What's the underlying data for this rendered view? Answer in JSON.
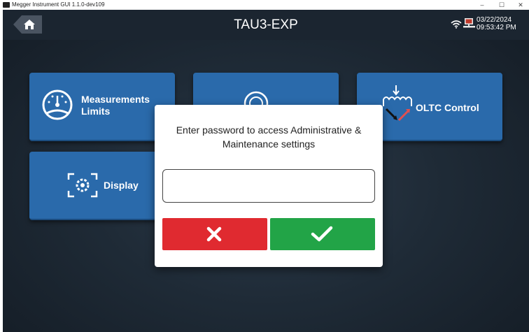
{
  "window": {
    "title": "Megger Instrument GUI 1.1.0-dev109",
    "controls": {
      "minimize": "–",
      "maximize": "☐",
      "close": "✕"
    }
  },
  "header": {
    "title": "TAU3-EXP",
    "date": "03/22/2024",
    "time": "09:53:42 PM",
    "icons": [
      "home-icon",
      "wifi-icon",
      "pc-connection-icon"
    ]
  },
  "tiles": [
    {
      "label_line1": "Measurements",
      "label_line2": "Limits",
      "icon": "gauge-icon"
    },
    {
      "label_line1": "",
      "label_line2": "",
      "icon": "settings-wheel-icon"
    },
    {
      "label_line1": "OLTC Control",
      "label_line2": "",
      "icon": "oltc-icon"
    },
    {
      "label_line1": "Display",
      "label_line2": "",
      "icon": "display-settings-icon"
    }
  ],
  "dialog": {
    "message": "Enter password to access Administrative & Maintenance settings",
    "password_value": "",
    "cancel_icon": "close-icon",
    "confirm_icon": "check-icon"
  },
  "colors": {
    "tile": "#2a6aab",
    "header": "#1b2530",
    "cancel": "#e02a30",
    "confirm": "#22a447"
  }
}
